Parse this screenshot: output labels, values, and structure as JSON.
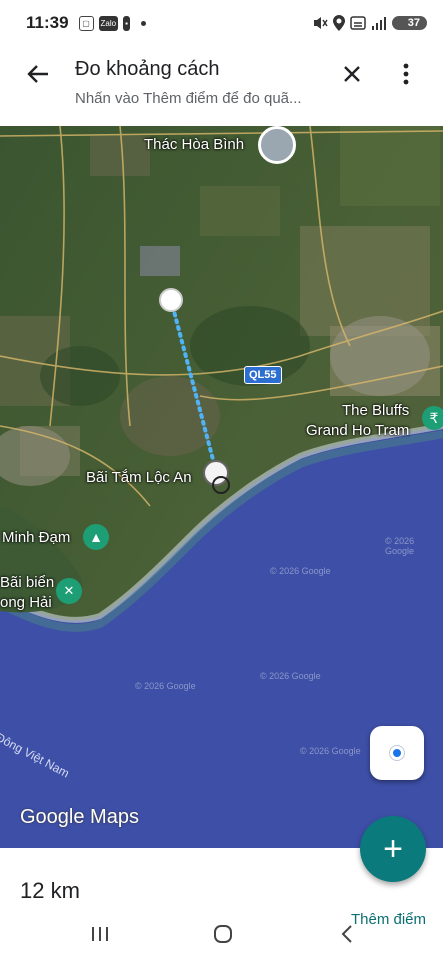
{
  "status_bar": {
    "time": "11:39",
    "left_icons": [
      "screenshot-icon",
      "zalo-icon",
      "single-notification-icon"
    ],
    "zalo_text": "Zalo",
    "right_icons": [
      "mute-icon",
      "location-icon",
      "wifi-icon",
      "signal-icon"
    ],
    "battery": "37"
  },
  "app_bar": {
    "title": "Đo khoảng cách",
    "subtitle": "Nhấn vào Thêm điểm để đo quã..."
  },
  "map": {
    "places": {
      "thac_hoa_binh": "Thác Hòa Bình",
      "the_bluffs": "The Bluffs",
      "grand_ho_tram": "Grand Ho Tram",
      "bai_tam_loc_an": "Bãi Tắm Lộc An",
      "minh_dam": "Minh Đạm",
      "bai_bien": "Bãi biển",
      "long_hai": "ong Hải"
    },
    "road": "QL55",
    "sea": "Đông Việt Nam",
    "watermarks": [
      "© 2026 Google",
      "© 2026 Google",
      "© 2026 Google",
      "© 2026 Google",
      "© 2026 Google"
    ],
    "brand": "Google Maps"
  },
  "measurement": {
    "distance": "12 km",
    "add_point_label": "Thêm điểm"
  },
  "colors": {
    "accent": "#0b7a7c",
    "route": "#4fb3f5",
    "sea": "#3d4fa6"
  }
}
